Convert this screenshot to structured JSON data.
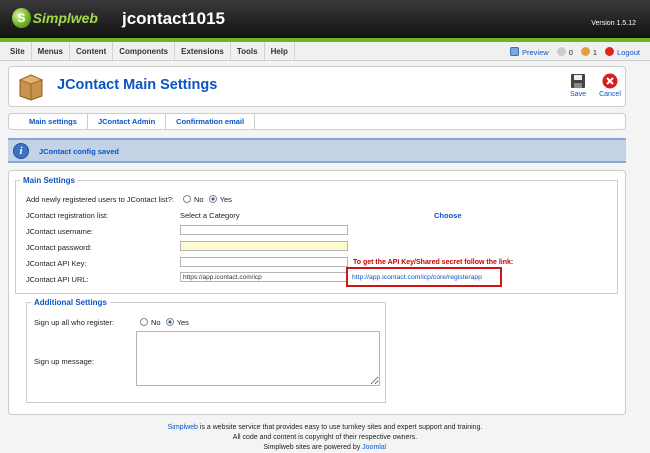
{
  "header": {
    "logo_text": "Simplweb",
    "site_name": "jcontact1015",
    "version": "Version 1.5.12"
  },
  "menu": [
    "Site",
    "Menus",
    "Content",
    "Components",
    "Extensions",
    "Tools",
    "Help"
  ],
  "status": {
    "preview": "Preview",
    "messages": "0",
    "users": "1",
    "logout": "Logout"
  },
  "toolbar": {
    "title": "JContact Main Settings",
    "save": "Save",
    "cancel": "Cancel"
  },
  "submenu": [
    "Main settings",
    "JContact Admin",
    "Confirmation email"
  ],
  "message": "JContact config saved",
  "main_settings": {
    "legend": "Main Settings",
    "add_users_label": "Add newly registered users to JContact list?:",
    "no": "No",
    "yes": "Yes",
    "registration_list_label": "JContact registration list:",
    "registration_list_value": "Select a Category",
    "choose": "Choose",
    "username_label": "JContact username:",
    "password_label": "JContact password:",
    "api_key_label": "JContact API Key:",
    "api_url_label": "JContact API URL:",
    "api_url_value": "https://app.icontact.com/icp",
    "api_note": "To get the API Key/Shared secret follow the link:",
    "api_link": "http://app.icontact.com/icp/core/registerapp"
  },
  "additional_settings": {
    "legend": "Additional Settings",
    "signup_label": "Sign up all who register:",
    "no": "No",
    "yes": "Yes",
    "signup_message_label": "Sign up message:"
  },
  "footer": {
    "line1_link": "Simplweb",
    "line1_text": " is a website service that provides easy to use turnkey sites and expert support and training.",
    "line2": "All code and content is copyright of their respective owners.",
    "line3_text": "Simplweb sites are powered by ",
    "line3_link": "Joomla!"
  }
}
